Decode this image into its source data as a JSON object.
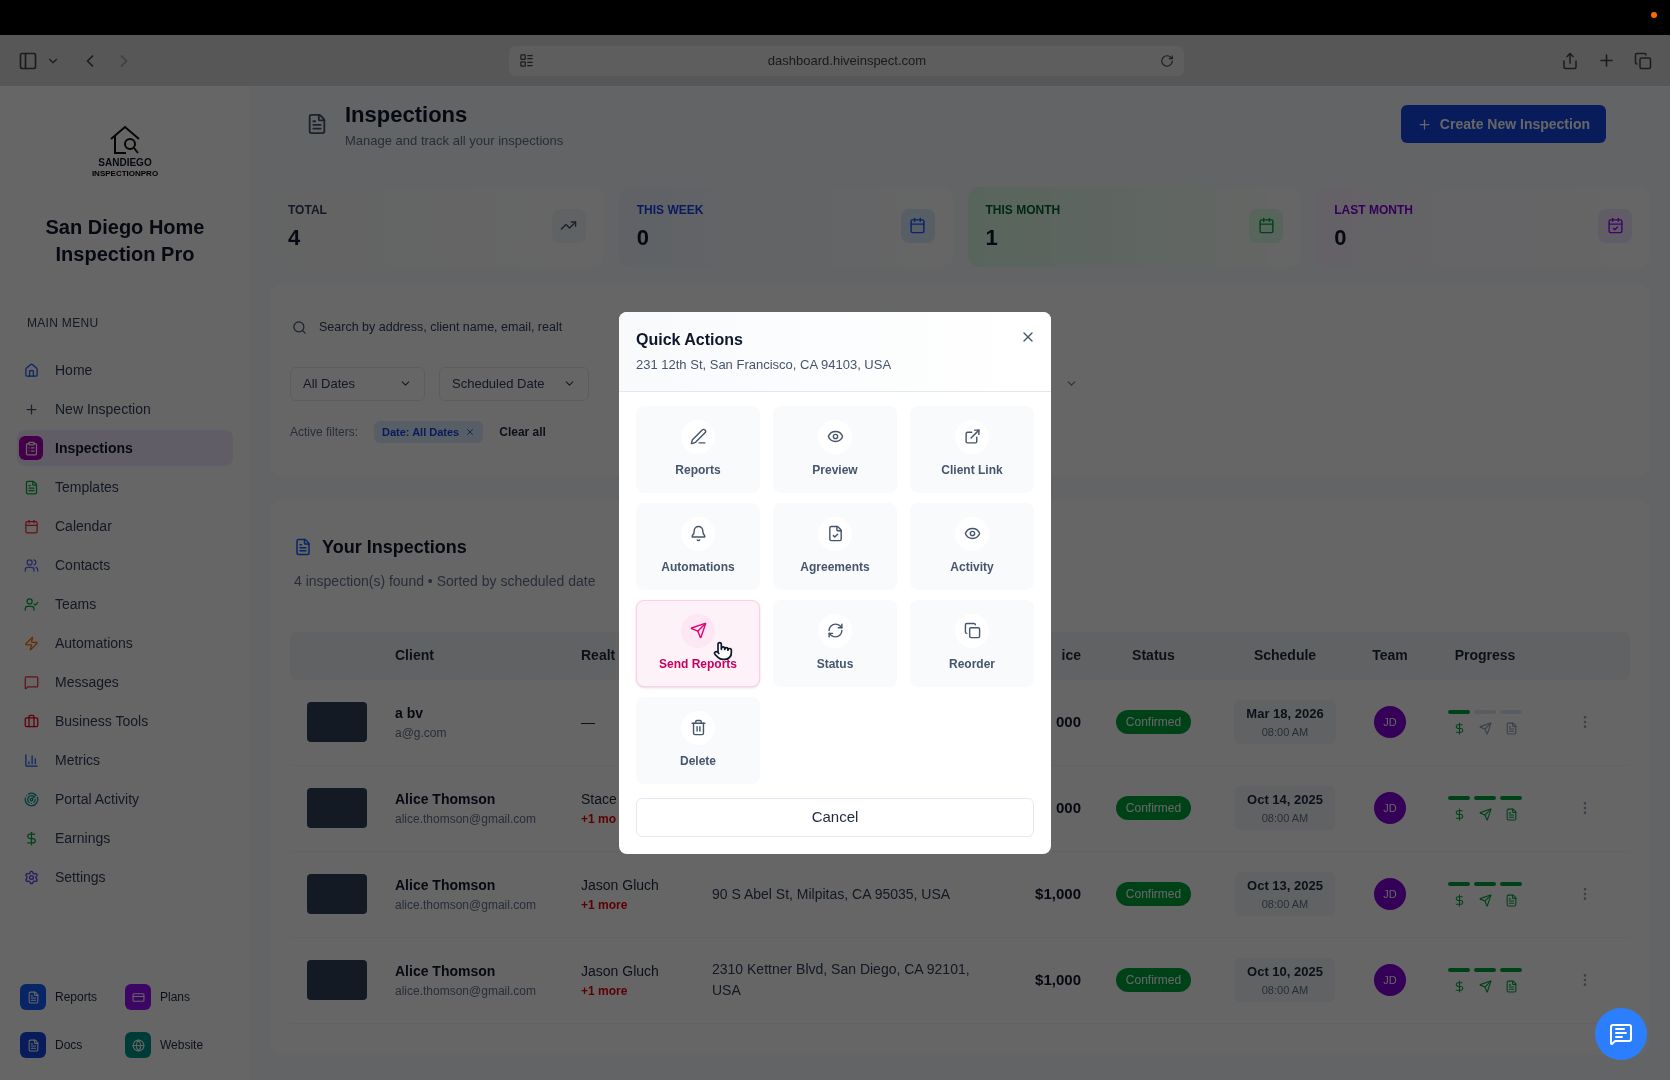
{
  "browser": {
    "url": "dashboard.hiveinspect.com"
  },
  "sidebar": {
    "logo_text": "SANDIEGO",
    "logo_subtext": "INSPECTIONPRO",
    "company": "San Diego Home Inspection Pro",
    "section": "MAIN MENU",
    "items": [
      {
        "label": "Home",
        "selected": false
      },
      {
        "label": "New Inspection",
        "selected": false
      },
      {
        "label": "Inspections",
        "selected": true
      },
      {
        "label": "Templates",
        "selected": false
      },
      {
        "label": "Calendar",
        "selected": false
      },
      {
        "label": "Contacts",
        "selected": false
      },
      {
        "label": "Teams",
        "selected": false
      },
      {
        "label": "Automations",
        "selected": false
      },
      {
        "label": "Messages",
        "selected": false
      },
      {
        "label": "Business Tools",
        "selected": false
      },
      {
        "label": "Metrics",
        "selected": false
      },
      {
        "label": "Portal Activity",
        "selected": false
      },
      {
        "label": "Earnings",
        "selected": false
      },
      {
        "label": "Settings",
        "selected": false
      }
    ],
    "shortcuts": [
      "Reports",
      "Plans",
      "Docs",
      "Website"
    ]
  },
  "header": {
    "title": "Inspections",
    "subtitle": "Manage and track all your inspections",
    "create_button": "Create New Inspection"
  },
  "stats": [
    {
      "label": "TOTAL",
      "value": "4"
    },
    {
      "label": "THIS WEEK",
      "value": "0"
    },
    {
      "label": "THIS MONTH",
      "value": "1"
    },
    {
      "label": "LAST MONTH",
      "value": "0"
    }
  ],
  "filters": {
    "search_placeholder": "Search by address, client name, email, realt",
    "date_range": "All Dates",
    "date_field": "Scheduled Date",
    "active_label": "Active filters:",
    "chips": [
      "Date: All Dates"
    ],
    "clear": "Clear all"
  },
  "inspections": {
    "title": "Your Inspections",
    "subtitle": "4 inspection(s) found • Sorted by scheduled date",
    "columns": {
      "client": "Client",
      "realtor": "Realt",
      "price": "ice",
      "status": "Status",
      "schedule": "Schedule",
      "team": "Team",
      "progress": "Progress"
    },
    "rows": [
      {
        "client": "a bv",
        "email": "a@g.com",
        "realtor": "—",
        "price": "000",
        "status": "Confirmed",
        "date": "Mar 18, 2026",
        "time": "08:00 AM",
        "team": "JD",
        "steps": [
          {
            "done": true
          },
          {
            "done": false
          },
          {
            "done": false
          }
        ]
      },
      {
        "client": "Alice Thomson",
        "email": "alice.thomson@gmail.com",
        "realtor": "Stace",
        "realtor_more": "+1 mo",
        "price": "000",
        "status": "Confirmed",
        "date": "Oct 14, 2025",
        "time": "08:00 AM",
        "team": "JD",
        "steps": [
          {
            "done": true
          },
          {
            "done": true
          },
          {
            "done": true
          }
        ]
      },
      {
        "client": "Alice Thomson",
        "email": "alice.thomson@gmail.com",
        "realtor": "Jason Gluch",
        "realtor_more": "+1 more",
        "address": "90 S Abel St, Milpitas, CA 95035, USA",
        "price": "$1,000",
        "status": "Confirmed",
        "date": "Oct 13, 2025",
        "time": "08:00 AM",
        "team": "JD",
        "steps": [
          {
            "done": true
          },
          {
            "done": true
          },
          {
            "done": true
          }
        ]
      },
      {
        "client": "Alice Thomson",
        "email": "alice.thomson@gmail.com",
        "realtor": "Jason Gluch",
        "realtor_more": "+1 more",
        "address": "2310 Kettner Blvd, San Diego, CA 92101, USA",
        "price": "$1,000",
        "status": "Confirmed",
        "date": "Oct 10, 2025",
        "time": "08:00 AM",
        "team": "JD",
        "steps": [
          {
            "done": true
          },
          {
            "done": true
          },
          {
            "done": true
          }
        ]
      }
    ]
  },
  "modal": {
    "title": "Quick Actions",
    "subtitle": "231 12th St, San Francisco, CA 94103, USA",
    "actions": [
      {
        "label": "Reports",
        "selected": false
      },
      {
        "label": "Preview",
        "selected": false
      },
      {
        "label": "Client Link",
        "selected": false
      },
      {
        "label": "Automations",
        "selected": false
      },
      {
        "label": "Agreements",
        "selected": false
      },
      {
        "label": "Activity",
        "selected": false
      },
      {
        "label": "Send Reports",
        "selected": true
      },
      {
        "label": "Status",
        "selected": false
      },
      {
        "label": "Reorder",
        "selected": false
      },
      {
        "label": "Delete",
        "selected": false
      }
    ],
    "cancel": "Cancel"
  }
}
